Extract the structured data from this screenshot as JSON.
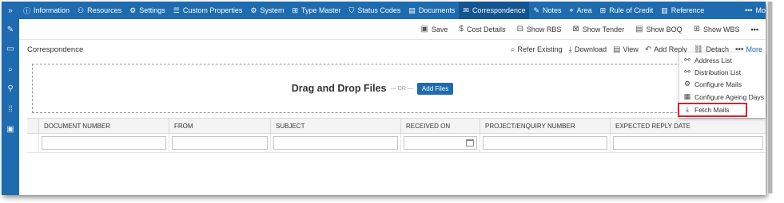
{
  "rail": {
    "items": [
      {
        "icon": "expand-icon",
        "glyph": "»"
      },
      {
        "icon": "pencil-icon",
        "glyph": "✎"
      },
      {
        "icon": "folder-icon",
        "glyph": "▭"
      },
      {
        "icon": "search-icon",
        "glyph": "⌕"
      },
      {
        "icon": "wrench-icon",
        "glyph": "⚲"
      },
      {
        "icon": "apps-icon",
        "glyph": "⁞⁞"
      },
      {
        "icon": "image-icon",
        "glyph": "▣"
      }
    ]
  },
  "nav": {
    "items": [
      {
        "label": "Information",
        "icon": "info-icon",
        "glyph": "ⓘ",
        "active": false
      },
      {
        "label": "Resources",
        "icon": "resources-icon",
        "glyph": "⚇",
        "active": false
      },
      {
        "label": "Settings",
        "icon": "settings-icon",
        "glyph": "⚙",
        "active": false
      },
      {
        "label": "Custom Properties",
        "icon": "list-icon",
        "glyph": "☰",
        "active": false
      },
      {
        "label": "System",
        "icon": "system-icon",
        "glyph": "⚙",
        "active": false
      },
      {
        "label": "Type Master",
        "icon": "type-icon",
        "glyph": "⊞",
        "active": false
      },
      {
        "label": "Status Codes",
        "icon": "status-icon",
        "glyph": "⛉",
        "active": false
      },
      {
        "label": "Documents",
        "icon": "documents-icon",
        "glyph": "▤",
        "active": false
      },
      {
        "label": "Correspondence",
        "icon": "mail-icon",
        "glyph": "✉",
        "active": true
      },
      {
        "label": "Notes",
        "icon": "notes-icon",
        "glyph": "✎",
        "active": false
      },
      {
        "label": "Area",
        "icon": "location-icon",
        "glyph": "⌖",
        "active": false
      },
      {
        "label": "Rule of Credit",
        "icon": "grid-icon",
        "glyph": "⊞",
        "active": false
      },
      {
        "label": "Reference",
        "icon": "reference-icon",
        "glyph": "▥",
        "active": false
      }
    ],
    "more_label": "Mo"
  },
  "toolbar": {
    "buttons": [
      {
        "label": "Save",
        "icon": "save-icon",
        "glyph": "▣"
      },
      {
        "label": "Cost Details",
        "icon": "dollar-icon",
        "glyph": "$"
      },
      {
        "label": "Show RBS",
        "icon": "rbs-icon",
        "glyph": "⊟"
      },
      {
        "label": "Show Tender",
        "icon": "tender-icon",
        "glyph": "⊠"
      },
      {
        "label": "Show BOQ",
        "icon": "boq-icon",
        "glyph": "▤"
      },
      {
        "label": "Show WBS",
        "icon": "wbs-icon",
        "glyph": "⊞"
      },
      {
        "label": "",
        "icon": "more-icon",
        "glyph": "•••"
      }
    ]
  },
  "panel": {
    "title": "Correspondence",
    "tools": [
      {
        "label": "Refer Existing",
        "icon": "search-icon",
        "glyph": "⌕"
      },
      {
        "label": "Download",
        "icon": "download-icon",
        "glyph": "⤓"
      },
      {
        "label": "View",
        "icon": "view-icon",
        "glyph": "▤"
      },
      {
        "label": "Add Reply",
        "icon": "reply-icon",
        "glyph": "↶"
      },
      {
        "label": "Detach",
        "icon": "detach-icon",
        "glyph": "⛓"
      }
    ],
    "more_label": "More"
  },
  "dropzone": {
    "title": "Drag and Drop Files",
    "or_text": "— OR —",
    "button_label": "Add Files"
  },
  "grid": {
    "columns": [
      "",
      "DOCUMENT NUMBER",
      "FROM",
      "SUBJECT",
      "RECEIVED ON",
      "PROJECT/ENQUIRY NUMBER",
      "EXPECTED REPLY DATE"
    ]
  },
  "menu": {
    "items": [
      {
        "label": "Address List",
        "icon": "share-icon",
        "glyph": "⚯"
      },
      {
        "label": "Distribution List",
        "icon": "share-icon",
        "glyph": "⚯"
      },
      {
        "label": "Configure Mails",
        "icon": "gear-icon",
        "glyph": "⚙"
      },
      {
        "label": "Configure Ageing Days",
        "icon": "calendar-icon",
        "glyph": "▦"
      },
      {
        "label": "Fetch Mails",
        "icon": "fetch-icon",
        "glyph": "⤓"
      }
    ],
    "highlighted": "Fetch Mails",
    "highlight_color": "#d9232e"
  },
  "colors": {
    "brand": "#1f6bb0",
    "active_tab": "#14548f"
  }
}
